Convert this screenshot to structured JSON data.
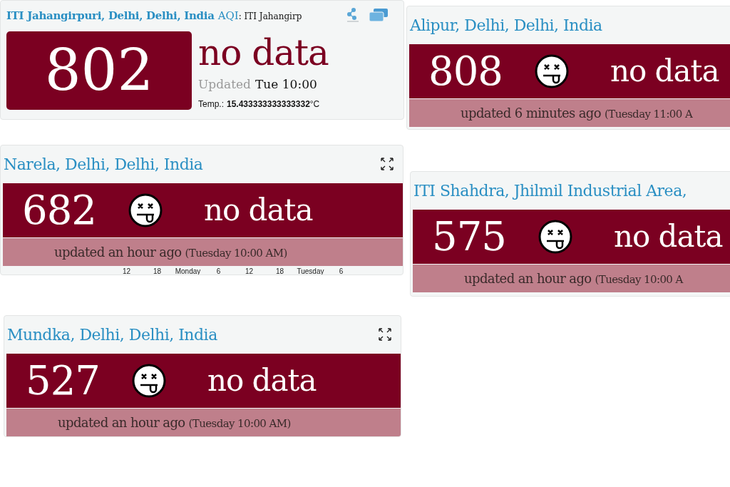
{
  "panels": [
    {
      "kind": "main",
      "title": "ITI Jahangirpuri, Delhi, Delhi, India",
      "aqi_label": "AQI",
      "aqi_suffix": ": ITI Jahangirp",
      "value": "802",
      "status": "no data",
      "updated_label": "Updated",
      "updated_time": "Tue 10:00",
      "temp_label": "Temp.:",
      "temp_value": "**15.433333333333332**°C"
    },
    {
      "kind": "band",
      "title": "Alipur, Delhi, Delhi, India",
      "value": "808",
      "status": "no data",
      "updated": "updated 6 minutes ago",
      "time": "(Tuesday 11:00 A",
      "expand": false
    },
    {
      "kind": "band",
      "title": "Narela, Delhi, Delhi, India",
      "value": "682",
      "status": "no data",
      "updated": "updated an hour ago",
      "time": "(Tuesday 10:00 AM)",
      "expand": true,
      "axis": [
        "12",
        "18",
        "Monday",
        "6",
        "12",
        "18",
        "Tuesday",
        "6"
      ]
    },
    {
      "kind": "band",
      "title": "ITI Shahdra, Jhilmil Industrial Area,",
      "value": "575",
      "status": "no data",
      "updated": "updated an hour ago",
      "time": "(Tuesday 10:00 A",
      "expand": false
    },
    {
      "kind": "band",
      "title": "Mundka, Delhi, Delhi, India",
      "value": "527",
      "status": "no data",
      "updated": "updated an hour ago",
      "time": "(Tuesday 10:00 AM)",
      "expand": true
    }
  ]
}
